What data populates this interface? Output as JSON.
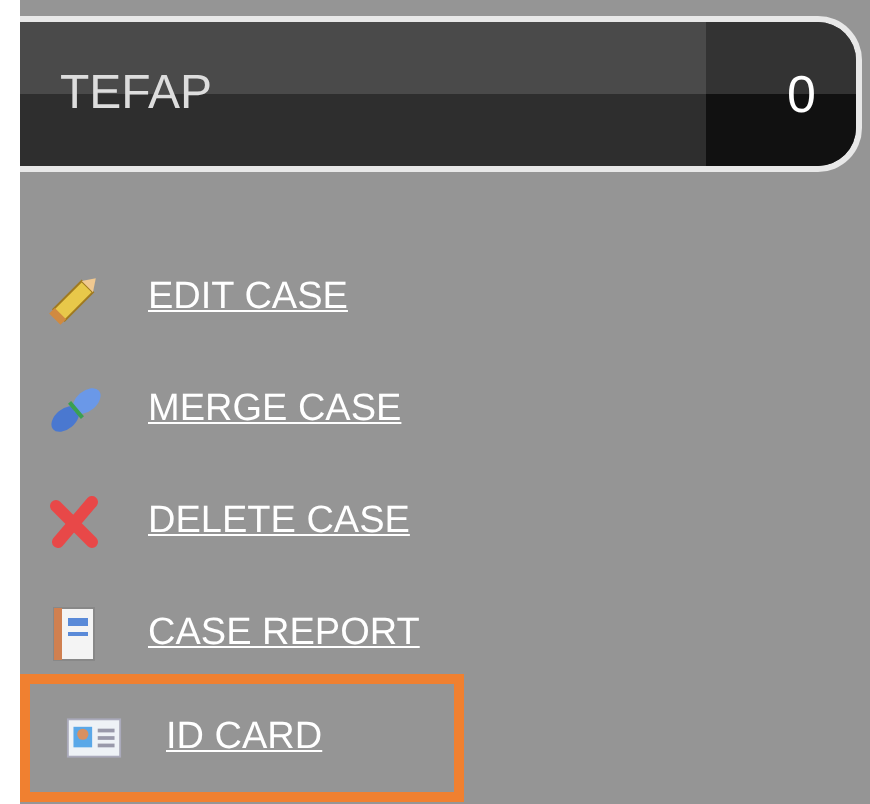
{
  "header": {
    "label": "TEFAP",
    "count": "0"
  },
  "actions": [
    {
      "label": "EDIT CASE",
      "kind": "pencil",
      "selected": false
    },
    {
      "label": "MERGE CASE",
      "kind": "merge",
      "selected": false
    },
    {
      "label": "DELETE CASE",
      "kind": "delete",
      "selected": false
    },
    {
      "label": "CASE REPORT",
      "kind": "report",
      "selected": false
    },
    {
      "label": "ID CARD",
      "kind": "idcard",
      "selected": true
    }
  ]
}
